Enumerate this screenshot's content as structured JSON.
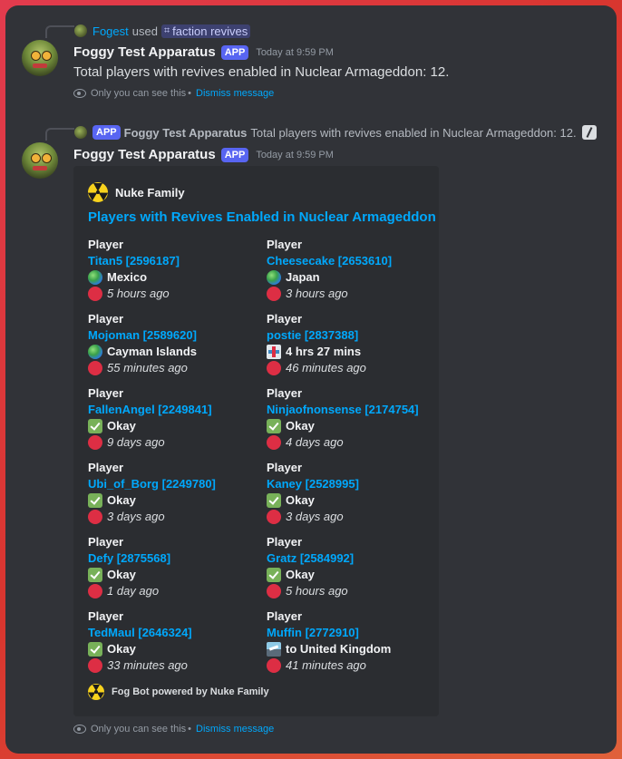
{
  "message1": {
    "reply_user": "Fogest",
    "reply_used": "used",
    "command": "faction revives",
    "author": "Foggy Test Apparatus",
    "badge": "APP",
    "timestamp": "Today at 9:59 PM",
    "content": "Total players with revives enabled in Nuclear Armageddon: 12.",
    "ephemeral_text": "Only you can see this",
    "dismiss": "Dismiss message"
  },
  "message2": {
    "reply_badge": "APP",
    "reply_author": "Foggy Test Apparatus",
    "reply_text": "Total players with revives enabled in Nuclear Armageddon: 12.",
    "author": "Foggy Test Apparatus",
    "badge": "APP",
    "timestamp": "Today at 9:59 PM",
    "ephemeral_text": "Only you can see this",
    "dismiss": "Dismiss message",
    "embed": {
      "author": "Nuke Family",
      "title": "Players with Revives Enabled in Nuclear Armageddon",
      "footer": "Fog Bot powered by Nuke Family",
      "fields": [
        {
          "name": "Player",
          "player": "Titan5 [2596187]",
          "status": "Mexico",
          "status_icon": "globe-icon",
          "time": "5 hours ago"
        },
        {
          "name": "Player",
          "player": "Cheesecake [2653610]",
          "status": "Japan",
          "status_icon": "globe-icon",
          "time": "3 hours ago"
        },
        {
          "name": "Player",
          "player": "Mojoman [2589620]",
          "status": "Cayman Islands",
          "status_icon": "globe-icon",
          "time": "55 minutes ago"
        },
        {
          "name": "Player",
          "player": "postie [2837388]",
          "status": "4 hrs 27 mins",
          "status_icon": "hospital-icon",
          "time": "46 minutes ago"
        },
        {
          "name": "Player",
          "player": "FallenAngel [2249841]",
          "status": "Okay",
          "status_icon": "check-icon",
          "time": "9 days ago"
        },
        {
          "name": "Player",
          "player": "Ninjaofnonsense [2174754]",
          "status": "Okay",
          "status_icon": "check-icon",
          "time": "4 days ago"
        },
        {
          "name": "Player",
          "player": "Ubi_of_Borg [2249780]",
          "status": "Okay",
          "status_icon": "check-icon",
          "time": "3 days ago"
        },
        {
          "name": "Player",
          "player": "Kaney [2528995]",
          "status": "Okay",
          "status_icon": "check-icon",
          "time": "3 days ago"
        },
        {
          "name": "Player",
          "player": "Defy [2875568]",
          "status": "Okay",
          "status_icon": "check-icon",
          "time": "1 day ago"
        },
        {
          "name": "Player",
          "player": "Gratz [2584992]",
          "status": "Okay",
          "status_icon": "check-icon",
          "time": "5 hours ago"
        },
        {
          "name": "Player",
          "player": "TedMaul [2646324]",
          "status": "Okay",
          "status_icon": "check-icon",
          "time": "33 minutes ago"
        },
        {
          "name": "Player",
          "player": "Muffin [2772910]",
          "status": "to United Kingdom",
          "status_icon": "plane-icon",
          "time": "41 minutes ago"
        }
      ]
    }
  },
  "colors": {
    "background": "#313338",
    "link": "#00a8fc",
    "app_badge": "#5865f2",
    "embed_bg": "#2b2d31"
  }
}
